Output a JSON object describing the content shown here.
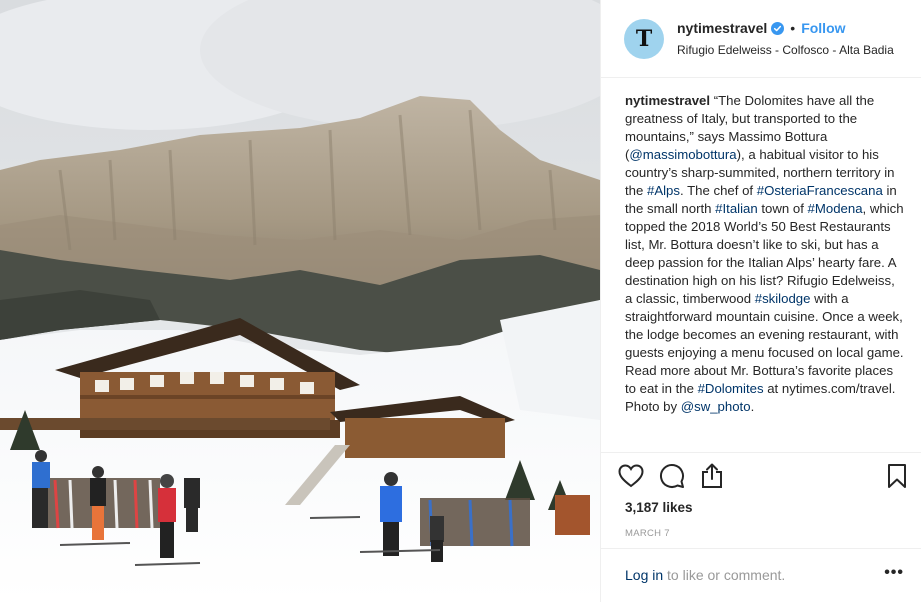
{
  "post": {
    "username": "nytimestravel",
    "verified": true,
    "follow_label": "Follow",
    "separator": "•",
    "location": "Rifugio Edelweiss - Colfosco - Alta Badia",
    "avatar_letter": "T",
    "avatar_color": "#9fd3ee",
    "photo_alt": "Snowy mountain lodge with skiers below rocky Dolomite peaks"
  },
  "caption": {
    "user": "nytimestravel",
    "t1": " “The Dolomites have all the greatness of Italy, but transported to the mountains,” says Massimo Bottura (",
    "m1": "@massimobottura",
    "t2": "), a habitual visitor to his country’s sharp-summited, northern territory in the ",
    "h1": "#Alps",
    "t3": ". The chef of ",
    "h2": "#OsteriaFrancescana",
    "t4": " in the small north ",
    "h3": "#Italian",
    "t5": " town of ",
    "h4": "#Modena",
    "t6": ", which topped the 2018 World’s 50 Best Restaurants list, Mr. Bottura doesn’t like to ski, but has a deep passion for the Italian Alps’ hearty fare. A destination high on his list? Rifugio Edelweiss, a classic, timberwood ",
    "h5": "#skilodge",
    "t7": " with a straightforward mountain cuisine. Once a week, the lodge becomes an evening restaurant, with guests enjoying a menu focused on local game. Read more about Mr. Bottura’s favorite places to eat in the ",
    "h6": "#Dolomites",
    "t8": " at nytimes.com/travel. Photo by ",
    "m2": "@sw_photo",
    "t9": "."
  },
  "actions": {
    "like_icon": "heart-icon",
    "comment_icon": "comment-icon",
    "share_icon": "share-icon",
    "save_icon": "bookmark-icon"
  },
  "stats": {
    "likes": "3,187 likes",
    "date": "MARCH 7"
  },
  "footer": {
    "login_link": "Log in",
    "login_rest": " to like or comment.",
    "more_label": "•••"
  },
  "colors": {
    "link_blue": "#3897f0",
    "hashtag": "#003569",
    "muted": "#999999",
    "border": "#efefef"
  }
}
